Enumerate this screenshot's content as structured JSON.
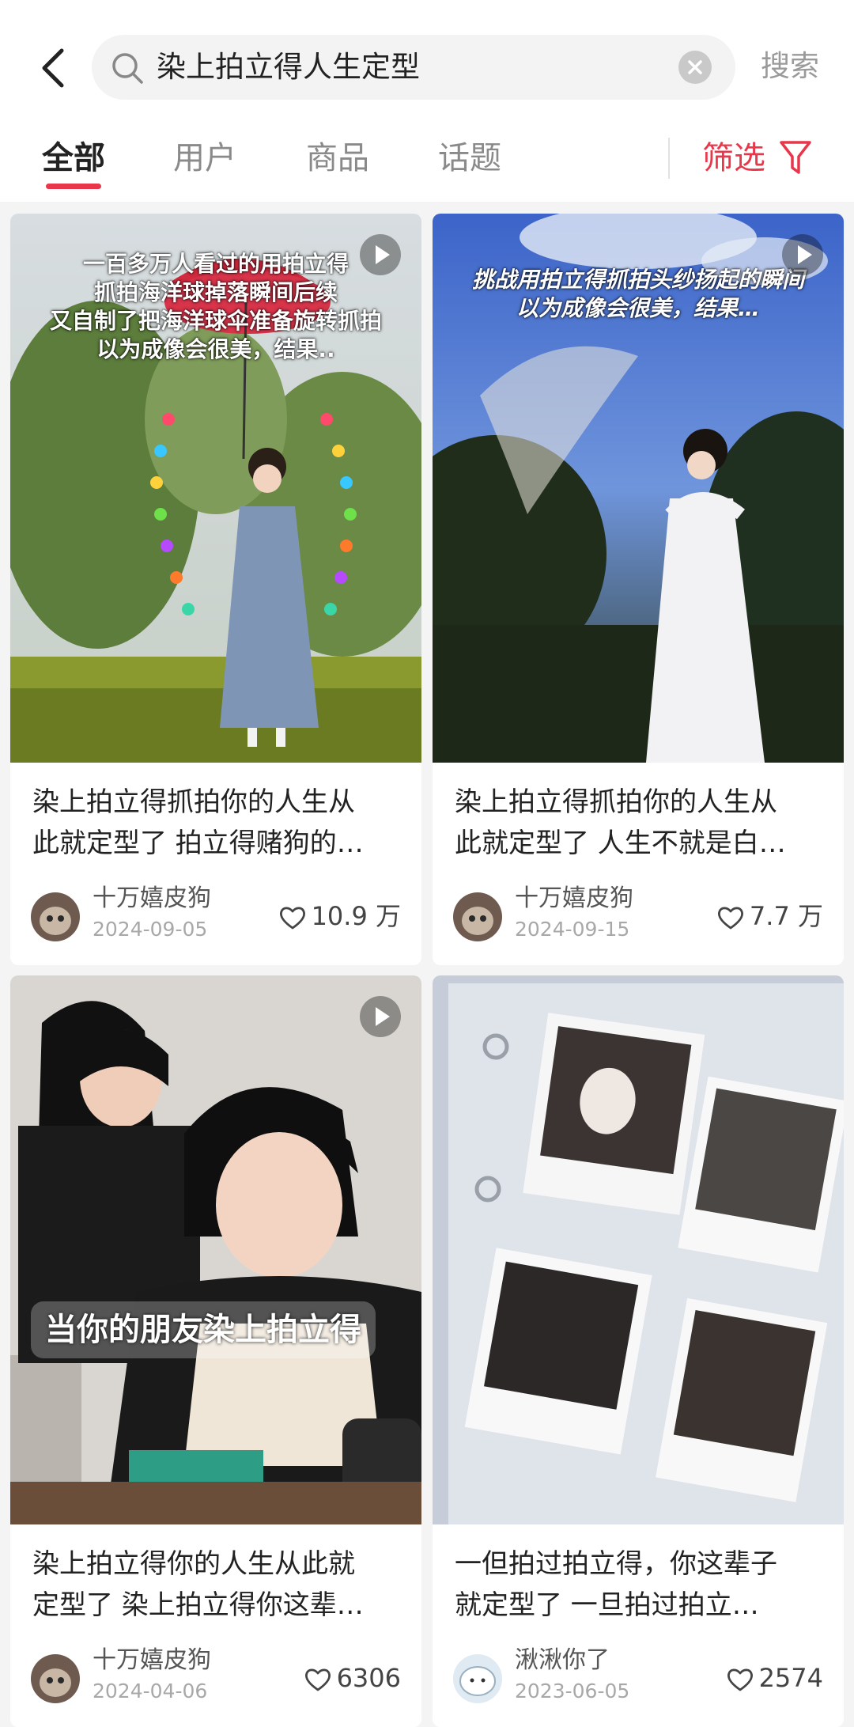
{
  "search": {
    "query": "染上拍立得人生定型",
    "action_label": "搜索"
  },
  "tabs": [
    {
      "label": "全部",
      "active": true
    },
    {
      "label": "用户",
      "active": false
    },
    {
      "label": "商品",
      "active": false
    },
    {
      "label": "话题",
      "active": false
    }
  ],
  "filter_label": "筛选",
  "colors": {
    "accent": "#e8374b"
  },
  "cards": [
    {
      "overlay_lines": [
        "一百多万人看过的用拍立得",
        "抓拍海洋球掉落瞬间后续",
        "又自制了把海洋球伞准备旋转抓拍",
        "以为成像会很美，结果.."
      ],
      "is_video": true,
      "title_lines": [
        "染上拍立得抓拍你的人生从",
        "此就定型了 拍立得赌狗的…"
      ],
      "author": "十万嬉皮狗",
      "date": "2024-09-05",
      "likes": "10.9 万"
    },
    {
      "overlay_lines": [
        "挑战用拍立得抓拍头纱扬起的瞬间",
        "以为成像会很美，结果…"
      ],
      "is_video": true,
      "title_lines": [
        "染上拍立得抓拍你的人生从",
        "此就定型了 人生不就是白…"
      ],
      "author": "十万嬉皮狗",
      "date": "2024-09-15",
      "likes": "7.7 万"
    },
    {
      "overlay_text": "当你的朋友染上拍立得",
      "is_video": true,
      "title_lines": [
        "染上拍立得你的人生从此就",
        "定型了 染上拍立得你这辈…"
      ],
      "author": "十万嬉皮狗",
      "date": "2024-04-06",
      "likes": "6306"
    },
    {
      "is_video": false,
      "title_lines": [
        "一但拍过拍立得，你这辈子",
        "就定型了 一旦拍过拍立…"
      ],
      "author": "湫湫你了",
      "date": "2023-06-05",
      "likes": "2574"
    }
  ]
}
